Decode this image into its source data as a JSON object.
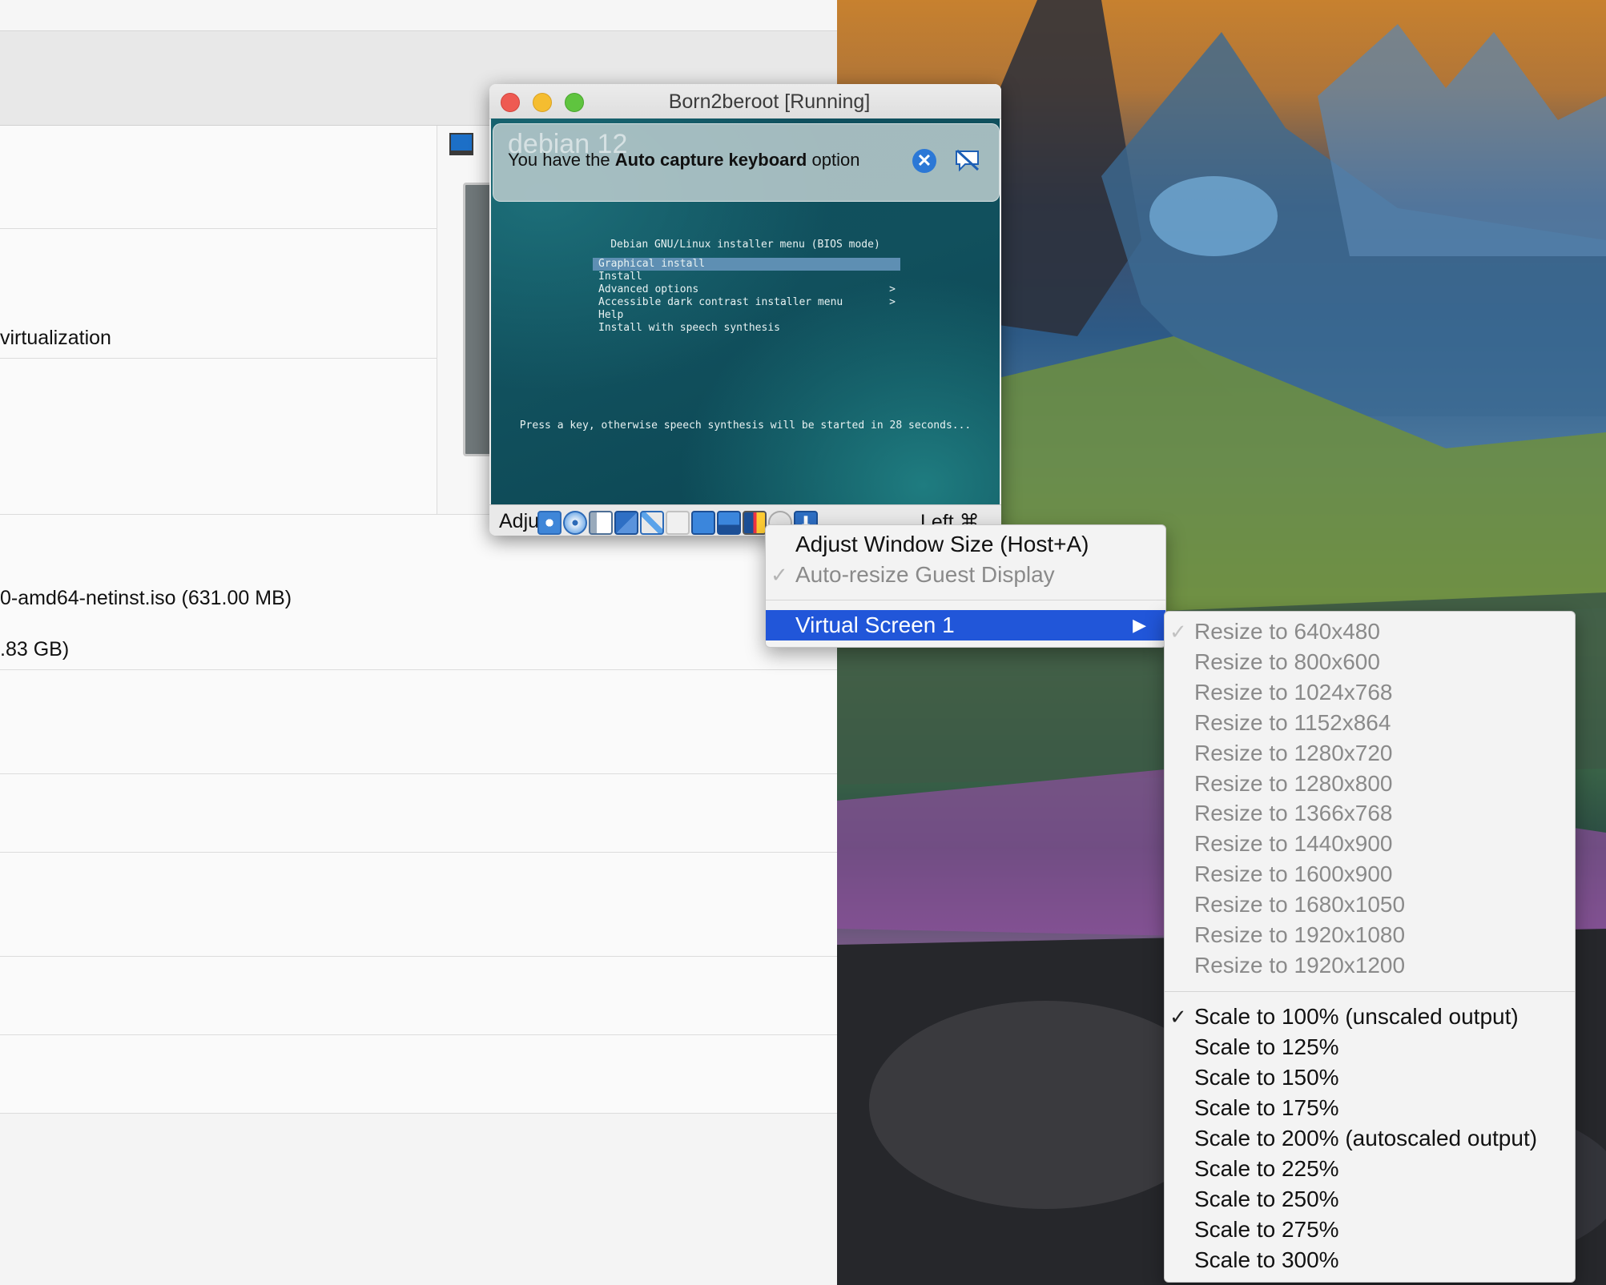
{
  "manager": {
    "row_virtualization": "virtualization",
    "row_iso": "0-amd64-netinst.iso (631.00 MB)",
    "row_disk": ".83 GB)"
  },
  "vm_window": {
    "title": "Born2beroot [Running]",
    "notification": {
      "prefix": "You have the ",
      "bold": "Auto capture keyboard",
      "suffix": " option",
      "close_icon": "close-x-icon",
      "mute_icon": "speech-bubble-mute-icon"
    },
    "guest": {
      "logo_text": "debian 12",
      "installer_title": "Debian GNU/Linux installer menu (BIOS mode)",
      "menu_items": [
        {
          "label": "Graphical install",
          "arrow": ""
        },
        {
          "label": "Install",
          "arrow": ""
        },
        {
          "label": "Advanced options",
          "arrow": ">"
        },
        {
          "label": "Accessible dark contrast installer menu",
          "arrow": ">"
        },
        {
          "label": "Help",
          "arrow": ""
        },
        {
          "label": "Install with speech synthesis",
          "arrow": ""
        }
      ],
      "selected_index": 0,
      "footer": "Press a key, otherwise speech synthesis will be started in 28 seconds..."
    },
    "statusbar": {
      "adjust_label": "Adjust",
      "host_key": "Left ⌘",
      "icons": [
        "hard-disk-icon",
        "optical-disc-icon",
        "audio-icon",
        "network-icon",
        "usb-icon",
        "shared-folder-icon",
        "display-icon",
        "recording-icon",
        "virtualization-icon",
        "mouse-integration-icon",
        "keyboard-capture-icon"
      ]
    }
  },
  "context_menu": {
    "items": [
      {
        "label": "Adjust Window Size (Host+A)",
        "enabled": true,
        "checked": false
      },
      {
        "label": "Auto-resize Guest Display",
        "enabled": false,
        "checked": true
      }
    ],
    "virtual_screen": {
      "label": "Virtual Screen 1",
      "arrow": "▶"
    }
  },
  "submenu": {
    "resize_items": [
      {
        "label": "Resize to 640x480",
        "checked": true
      },
      {
        "label": "Resize to 800x600",
        "checked": false
      },
      {
        "label": "Resize to 1024x768",
        "checked": false
      },
      {
        "label": "Resize to 1152x864",
        "checked": false
      },
      {
        "label": "Resize to 1280x720",
        "checked": false
      },
      {
        "label": "Resize to 1280x800",
        "checked": false
      },
      {
        "label": "Resize to 1366x768",
        "checked": false
      },
      {
        "label": "Resize to 1440x900",
        "checked": false
      },
      {
        "label": "Resize to 1600x900",
        "checked": false
      },
      {
        "label": "Resize to 1680x1050",
        "checked": false
      },
      {
        "label": "Resize to 1920x1080",
        "checked": false
      },
      {
        "label": "Resize to 1920x1200",
        "checked": false
      }
    ],
    "scale_items": [
      {
        "label": "Scale to 100% (unscaled output)",
        "checked": true
      },
      {
        "label": "Scale to 125%",
        "checked": false
      },
      {
        "label": "Scale to 150%",
        "checked": false
      },
      {
        "label": "Scale to 175%",
        "checked": false
      },
      {
        "label": "Scale to 200% (autoscaled output)",
        "checked": false
      },
      {
        "label": "Scale to 225%",
        "checked": false
      },
      {
        "label": "Scale to 250%",
        "checked": false
      },
      {
        "label": "Scale to 275%",
        "checked": false
      },
      {
        "label": "Scale to 300%",
        "checked": false
      }
    ],
    "check_glyph": "✓"
  },
  "colors": {
    "menu_highlight": "#2156d9",
    "installer_selection": "#5e8fb3",
    "traffic_close": "#ee5a52",
    "traffic_minimize": "#f5bd30",
    "traffic_zoom": "#5fc43f"
  }
}
